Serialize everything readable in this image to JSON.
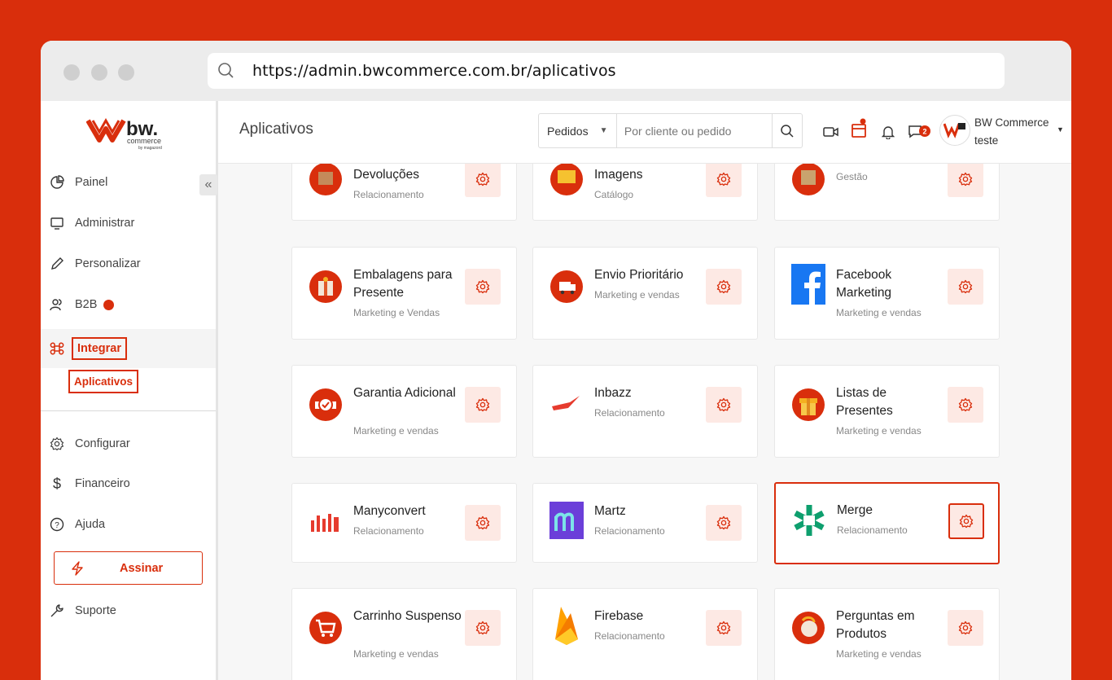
{
  "browser": {
    "url": "https://admin.bwcommerce.com.br/aplicativos"
  },
  "brand": {
    "logo_text": "bw.",
    "logo_sub": "commerce",
    "logo_by": "by magazord",
    "accent": "#D92E0C"
  },
  "sidebar": {
    "items": [
      {
        "label": "Painel",
        "icon": "pie-chart-icon"
      },
      {
        "label": "Administrar",
        "icon": "monitor-icon"
      },
      {
        "label": "Personalizar",
        "icon": "pencil-icon"
      },
      {
        "label": "B2B",
        "icon": "users-icon"
      },
      {
        "label": "Integrar",
        "icon": "command-icon"
      },
      {
        "label": "Configurar",
        "icon": "gear-icon"
      },
      {
        "label": "Financeiro",
        "icon": "dollar-icon"
      },
      {
        "label": "Ajuda",
        "icon": "help-icon"
      },
      {
        "label": "Suporte",
        "icon": "wrench-icon"
      }
    ],
    "sub_item": "Aplicativos",
    "assinar": "Assinar",
    "collapse_icon": "«"
  },
  "header": {
    "title": "Aplicativos",
    "search_select": "Pedidos",
    "search_placeholder": "Por cliente ou pedido",
    "chat_badge": "2",
    "user_name": "BW Commerce",
    "user_sub": "teste"
  },
  "apps": [
    {
      "name": "Devoluções",
      "category": "Relacionamento"
    },
    {
      "name": "Imagens",
      "category": "Catálogo"
    },
    {
      "name": "",
      "category": "Gestão"
    },
    {
      "name": "Embalagens para Presente",
      "category": "Marketing e Vendas"
    },
    {
      "name": "Envio Prioritário",
      "category": "Marketing e vendas"
    },
    {
      "name": "Facebook Marketing",
      "category": "Marketing e vendas"
    },
    {
      "name": "Garantia Adicional",
      "category": "Marketing e vendas"
    },
    {
      "name": "Inbazz",
      "category": "Relacionamento"
    },
    {
      "name": "Listas de Presentes",
      "category": "Marketing e vendas"
    },
    {
      "name": "Manyconvert",
      "category": "Relacionamento"
    },
    {
      "name": "Martz",
      "category": "Relacionamento"
    },
    {
      "name": "Merge",
      "category": "Relacionamento"
    },
    {
      "name": "Carrinho Suspenso",
      "category": "Marketing e vendas"
    },
    {
      "name": "Firebase",
      "category": "Relacionamento"
    },
    {
      "name": "Perguntas em Produtos",
      "category": "Marketing e vendas"
    }
  ]
}
